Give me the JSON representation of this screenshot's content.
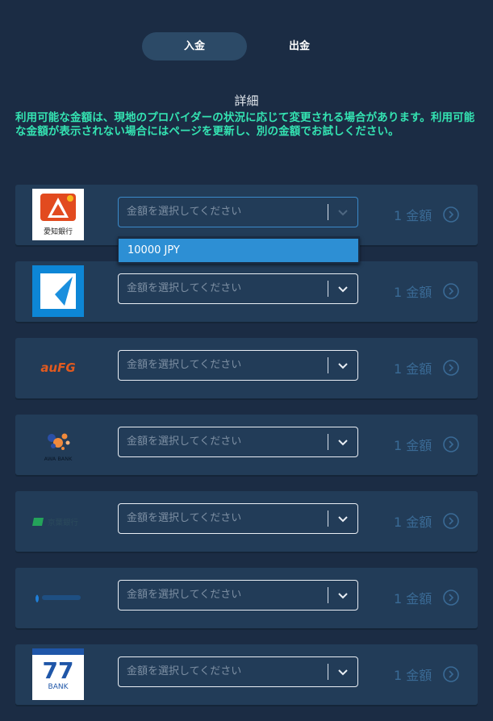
{
  "tabs": {
    "deposit": "入金",
    "withdraw": "出金"
  },
  "section": {
    "title": "詳細",
    "notice": "利用可能な金額は、現地のプロバイダーの状況に応じて変更される場合があります。利用可能な金額が表示されない場合にはページを更新し、別の金額でお試しください。"
  },
  "select_placeholder": "金額を選択してください",
  "amount_label": "1 金額",
  "dropdown": {
    "option": "10000 JPY"
  },
  "banks": [
    {
      "logo": "aichi-bank-logo",
      "logo_text": "愛知銀行"
    },
    {
      "logo": "blue-bank-logo"
    },
    {
      "logo": "aufg-logo",
      "logo_text": "auFG"
    },
    {
      "logo": "awa-bank-logo",
      "logo_text": "AWA BANK"
    },
    {
      "logo": "green-bank-logo",
      "logo_text": "京葉銀行"
    },
    {
      "logo": "blue-drop-bank-logo"
    },
    {
      "logo": "77-bank-logo",
      "logo_text": "77",
      "logo_subtext": "BANK"
    }
  ],
  "colors": {
    "background": "#1b2c44",
    "row": "#223c58",
    "notice": "#34e3b2",
    "dropdown_highlight": "#2d8fd4",
    "muted_link": "#3a6a95"
  }
}
